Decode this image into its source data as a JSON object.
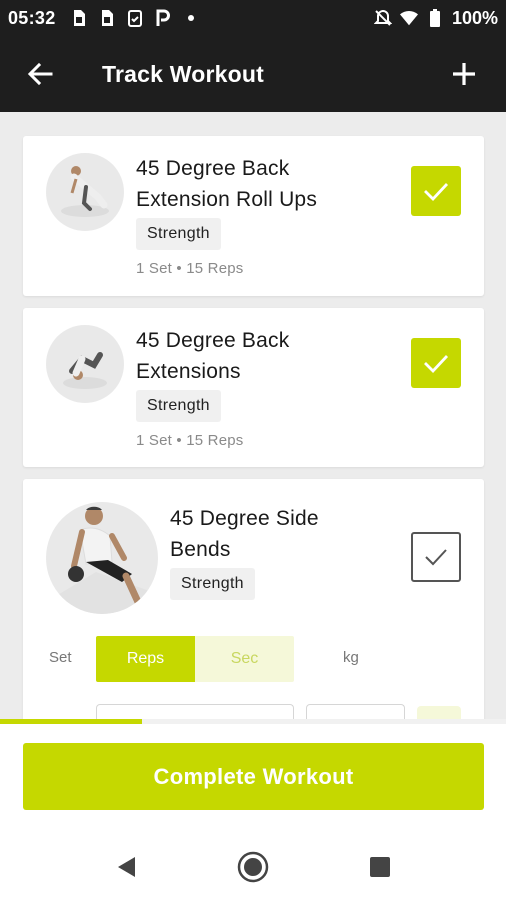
{
  "status": {
    "time": "05:32",
    "battery": "100%",
    "icons_left": [
      "sim-card-icon",
      "sim-card-icon",
      "clipboard-check-icon",
      "p-app-icon",
      "dot-icon"
    ],
    "icons_right": [
      "mute-bell-icon",
      "wifi-icon",
      "battery-icon"
    ]
  },
  "appbar": {
    "title": "Track Workout",
    "back_icon": "arrow-left-icon",
    "add_icon": "plus-icon"
  },
  "exercises": [
    {
      "name_line1": "45 Degree Back",
      "name_line2": "Extension Roll Ups",
      "tag": "Strength",
      "meta": "1 Set • 15 Reps",
      "completed": true
    },
    {
      "name_line1": "45 Degree Back",
      "name_line2": "Extensions",
      "tag": "Strength",
      "meta": "1 Set • 15 Reps",
      "completed": true
    },
    {
      "name_line1": "45 Degree Side",
      "name_line2": "Bends",
      "tag": "Strength",
      "completed": false
    }
  ],
  "set_table": {
    "set_label": "Set",
    "reps_label": "Reps",
    "sec_label": "Sec",
    "kg_label": "kg",
    "selected_mode": "Reps"
  },
  "progress": 0.28,
  "complete_button": "Complete Workout",
  "nav": [
    "back-triangle-icon",
    "home-circle-icon",
    "recents-square-icon"
  ],
  "colors": {
    "accent": "#c5d800",
    "bar_background": "#1e1e1e",
    "page_background": "#ececec"
  }
}
